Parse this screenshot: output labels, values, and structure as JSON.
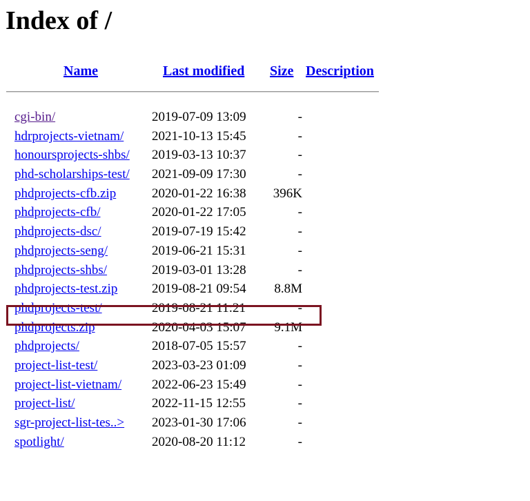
{
  "page": {
    "title": "Index of /"
  },
  "columns": {
    "name": "Name",
    "last_modified": "Last modified",
    "size": "Size",
    "description": "Description"
  },
  "entries": [
    {
      "name": "cgi-bin/",
      "modified": "2019-07-09 13:09",
      "size": "-",
      "visited": true
    },
    {
      "name": "hdrprojects-vietnam/",
      "modified": "2021-10-13 15:45",
      "size": "-"
    },
    {
      "name": "honoursprojects-shbs/",
      "modified": "2019-03-13 10:37",
      "size": "-"
    },
    {
      "name": "phd-scholarships-test/",
      "modified": "2021-09-09 17:30",
      "size": "-"
    },
    {
      "name": "phdprojects-cfb.zip",
      "modified": "2020-01-22 16:38",
      "size": "396K"
    },
    {
      "name": "phdprojects-cfb/",
      "modified": "2020-01-22 17:05",
      "size": "-"
    },
    {
      "name": "phdprojects-dsc/",
      "modified": "2019-07-19 15:42",
      "size": "-"
    },
    {
      "name": "phdprojects-seng/",
      "modified": "2019-06-21 15:31",
      "size": "-"
    },
    {
      "name": "phdprojects-shbs/",
      "modified": "2019-03-01 13:28",
      "size": "-"
    },
    {
      "name": "phdprojects-test.zip",
      "modified": "2019-08-21 09:54",
      "size": "8.8M",
      "highlighted": true
    },
    {
      "name": "phdprojects-test/",
      "modified": "2019-08-21 11:21",
      "size": "-"
    },
    {
      "name": "phdprojects.zip",
      "modified": "2020-04-03 15:07",
      "size": "9.1M"
    },
    {
      "name": "phdprojects/",
      "modified": "2018-07-05 15:57",
      "size": "-"
    },
    {
      "name": "project-list-test/",
      "modified": "2023-03-23 01:09",
      "size": "-"
    },
    {
      "name": "project-list-vietnam/",
      "modified": "2022-06-23 15:49",
      "size": "-"
    },
    {
      "name": "project-list/",
      "modified": "2022-11-15 12:55",
      "size": "-"
    },
    {
      "name": "sgr-project-list-tes..>",
      "modified": "2023-01-30 17:06",
      "size": "-"
    },
    {
      "name": "spotlight/",
      "modified": "2020-08-20 11:12",
      "size": "-"
    }
  ],
  "colors": {
    "link": "#0000ee",
    "visited_link": "#551a8b",
    "highlight_border": "#7b1421"
  }
}
